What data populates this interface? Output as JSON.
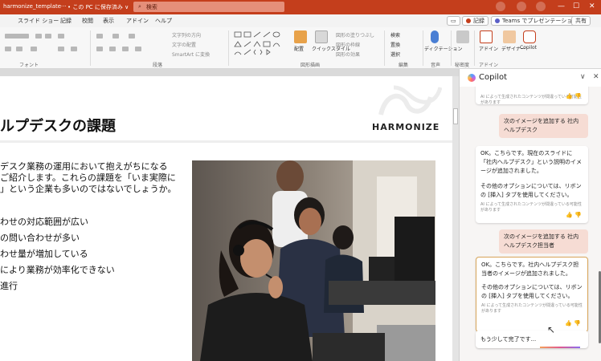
{
  "titlebar": {
    "file_name": "harmonize_template···",
    "save_status": "• この PC に保存済み ∨",
    "search_placeholder": "検索",
    "window_controls": [
      "—",
      "☐",
      "✕"
    ]
  },
  "tabs": {
    "items": [
      "スライド ショー",
      "記録",
      "校閲",
      "表示",
      "アドイン",
      "ヘルプ"
    ],
    "comment_icon": "comment-icon",
    "record_label": "記録",
    "teams_label": "Teams でプレゼンテーション",
    "share_label": "共有"
  },
  "ribbon": {
    "groups": [
      "フォント",
      "段落",
      "図形描画",
      "編集",
      "音声",
      "秘密度",
      "アドイン"
    ],
    "paragraph_items": [
      "文字列の方向",
      "文字の配置",
      "SmartArt に変換"
    ],
    "drawing_items": [
      "配置",
      "クイックスタイル",
      "図形の塗りつぶし",
      "図形の枠線",
      "図形の効果"
    ],
    "edit_items": [
      "検索",
      "置換",
      "選択"
    ],
    "voice_label": "ディクテーション",
    "sensitivity_label": "秘密度",
    "addin_label": "アドイン",
    "designer_label": "デザイナー",
    "copilot_label": "Copilot"
  },
  "slide": {
    "title": "ルプデスクの課題",
    "brand": "HARMONIZE",
    "intro_lines": [
      "デスク業務の運用において抱えがちになる",
      "ご紹介します。これらの課題を「いま実際に",
      "」という企業も多いのではないでしょうか。"
    ],
    "bullets": [
      "わせの対応範囲が広い",
      "の問い合わせが多い",
      "わせ量が増加している",
      "により業務が効率化できない",
      "進行"
    ]
  },
  "copilot": {
    "title": "Copilot",
    "prev_card_note": "AI によって生成されたコンテンツが間違っている可能性があります",
    "user_msg_1": "次のイメージを追加する 社内ヘルプデスク",
    "reply_1_lines": [
      "OK。こちらです。現在のスライドに「社内ヘルプデスク」という説明のイメージが追加されました。",
      "その他のオプションについては、リボンの [挿入] タブを使用してください。"
    ],
    "ai_note": "AI によって生成されたコンテンツが間違っている可能性があります",
    "user_msg_2": "次のイメージを追加する 社内ヘルプデスク担当者",
    "reply_2_lines": [
      "OK。こちらです。社内ヘルプデスク担当者のイメージが追加されました。",
      "その他のオプションについては、リボンの [挿入] タブを使用してください。"
    ],
    "status": "もう少して完了です..."
  }
}
